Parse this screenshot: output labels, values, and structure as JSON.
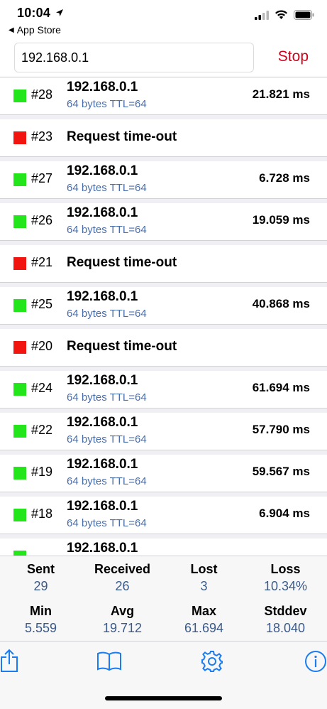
{
  "status_bar": {
    "time": "10:04",
    "back_label": "App Store"
  },
  "header": {
    "host_value": "192.168.0.1",
    "stop_label": "Stop"
  },
  "colors": {
    "ok": "#22e51a",
    "fail": "#f2140f",
    "accent": "#1a7cf0",
    "stop": "#d0021b"
  },
  "rows": [
    {
      "status": "ok",
      "seq": "#28",
      "host": "192.168.0.1",
      "detail": "64 bytes TTL=64",
      "time": "21.821 ms"
    },
    {
      "status": "fail",
      "seq": "#23",
      "message": "Request time-out"
    },
    {
      "status": "ok",
      "seq": "#27",
      "host": "192.168.0.1",
      "detail": "64 bytes TTL=64",
      "time": "6.728 ms"
    },
    {
      "status": "ok",
      "seq": "#26",
      "host": "192.168.0.1",
      "detail": "64 bytes TTL=64",
      "time": "19.059 ms"
    },
    {
      "status": "fail",
      "seq": "#21",
      "message": "Request time-out"
    },
    {
      "status": "ok",
      "seq": "#25",
      "host": "192.168.0.1",
      "detail": "64 bytes TTL=64",
      "time": "40.868 ms"
    },
    {
      "status": "fail",
      "seq": "#20",
      "message": "Request time-out"
    },
    {
      "status": "ok",
      "seq": "#24",
      "host": "192.168.0.1",
      "detail": "64 bytes TTL=64",
      "time": "61.694 ms"
    },
    {
      "status": "ok",
      "seq": "#22",
      "host": "192.168.0.1",
      "detail": "64 bytes TTL=64",
      "time": "57.790 ms"
    },
    {
      "status": "ok",
      "seq": "#19",
      "host": "192.168.0.1",
      "detail": "64 bytes TTL=64",
      "time": "59.567 ms"
    },
    {
      "status": "ok",
      "seq": "#18",
      "host": "192.168.0.1",
      "detail": "64 bytes TTL=64",
      "time": "6.904 ms"
    },
    {
      "status": "ok",
      "seq": "",
      "host": "192.168.0.1",
      "detail": "",
      "time": ""
    }
  ],
  "stats": [
    {
      "label": "Sent",
      "value": "29"
    },
    {
      "label": "Received",
      "value": "26"
    },
    {
      "label": "Lost",
      "value": "3"
    },
    {
      "label": "Loss",
      "value": "10.34%"
    },
    {
      "label": "Min",
      "value": "5.559"
    },
    {
      "label": "Avg",
      "value": "19.712"
    },
    {
      "label": "Max",
      "value": "61.694"
    },
    {
      "label": "Stddev",
      "value": "18.040"
    }
  ],
  "toolbar": {
    "icons": [
      "share-icon",
      "book-icon",
      "gear-icon",
      "info-icon"
    ]
  }
}
